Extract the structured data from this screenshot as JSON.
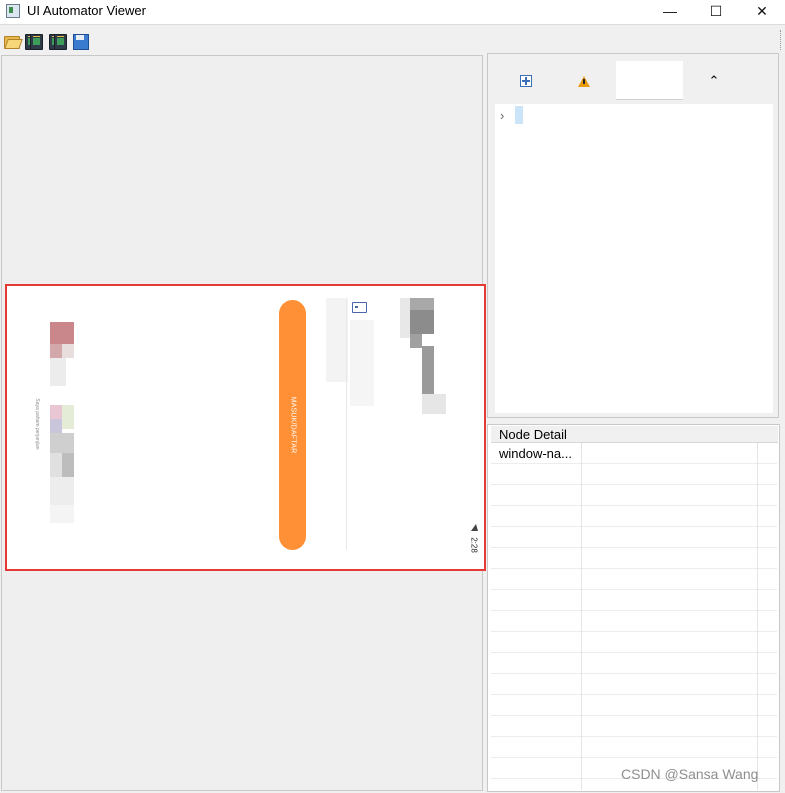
{
  "window": {
    "title": "UI Automator Viewer",
    "controls": {
      "minimize": "—",
      "maximize": "☐",
      "close": "✕"
    }
  },
  "toolbar": {
    "icons": [
      "folder-open-icon",
      "device-screenshot-icon",
      "device-screenshot-compressed-icon",
      "save-icon"
    ]
  },
  "device_screen": {
    "login_button_label": "MASUK/DAFTAR",
    "login_button_color": "#ff9035",
    "status_time": "2:28",
    "caption": "Saya paham perjanjian",
    "highlight_color": "#e53935"
  },
  "hierarchy": {
    "toolbar_icons": [
      "expand-all-icon",
      "warning-icon",
      "collapse-icon"
    ],
    "collapse_glyph": "⌃",
    "tree_arrow": "›"
  },
  "node_detail": {
    "title": "Node Detail",
    "rows": [
      {
        "key": "window-na...",
        "value": ""
      }
    ]
  },
  "watermark": "CSDN @Sansa Wang"
}
